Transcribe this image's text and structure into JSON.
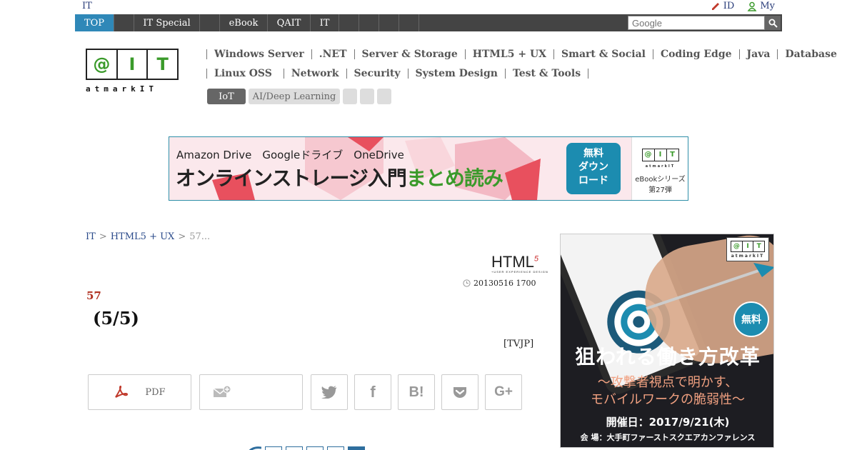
{
  "util": {
    "left": "IT",
    "id_label": "ID",
    "my_label": "My"
  },
  "nav": {
    "items": [
      "TOP",
      "",
      "IT Special",
      "",
      "eBook",
      "QAIT",
      "IT",
      "",
      "",
      "",
      ""
    ],
    "search_placeholder": "Google"
  },
  "logo": {
    "boxes": [
      "@",
      "I",
      "T"
    ],
    "text": "atmarkIT"
  },
  "categories": {
    "row1": [
      "Windows Server",
      ".NET",
      "Server & Storage",
      "HTML5 + UX",
      "Smart & Social",
      "Coding Edge",
      "Java",
      "Database"
    ],
    "row2": [
      "Linux  OSS",
      "Network",
      "Security",
      "System Design",
      "Test & Tools"
    ],
    "tags": [
      "IoT",
      "AI/Deep Learning",
      "",
      "",
      ""
    ]
  },
  "banner": {
    "sub": "Amazon Drive　Googleドライブ　OneDrive",
    "main": "オンラインストレージ入門",
    "accent": "まとめ読み",
    "btn_line1": "無料",
    "btn_line2": "ダウン",
    "btn_line3": "ロード",
    "side_series": "eBookシリーズ",
    "side_num": "第27弾"
  },
  "breadcrumb": {
    "items": [
      "IT",
      "HTML5 + UX",
      "57..."
    ],
    "sep": ">"
  },
  "article": {
    "html5_logo": "HTML",
    "html5_sup": "5",
    "html5_tiny": "+USER EXPERIENCE DESIGN",
    "date": "20130516 1700",
    "series_num": "57",
    "title": "(5/5)",
    "author": "[TVJP]"
  },
  "share": {
    "pdf": "PDF",
    "mail": "",
    "twitter": "twitter",
    "facebook": "f",
    "hatena": "B!",
    "pocket": "pocket",
    "gplus": "G+"
  },
  "side_ad": {
    "free": "無料",
    "title": "狙われる働き方改革",
    "sub_line1": "〜攻撃者視点で明かす、",
    "sub_line2": "モバイルワークの脆弱性〜",
    "date": "開催日：2017/9/21(木)",
    "venue": "会 場：大手町ファーストスクエアカンファレンス",
    "logo_text": "atmarkIT"
  },
  "colors": {
    "nav_bg": "#444444",
    "nav_active": "#2f88b8",
    "accent_green": "#3a9a2a",
    "series_red": "#b03020",
    "link_blue": "#2a4a8a"
  }
}
